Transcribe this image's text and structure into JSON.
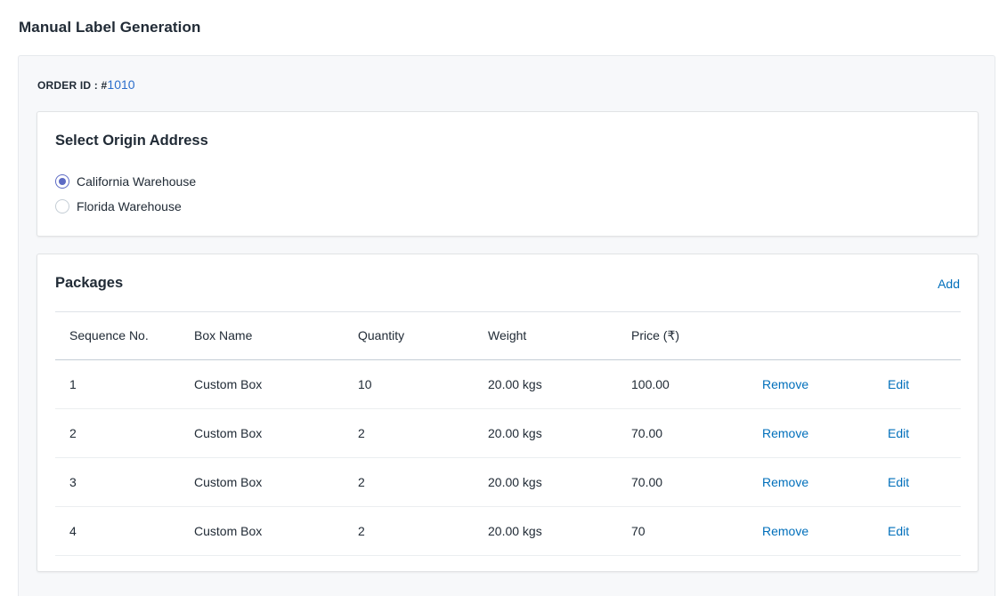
{
  "page": {
    "title": "Manual Label Generation"
  },
  "order": {
    "label": "ORDER ID : #",
    "value": "1010"
  },
  "origin": {
    "title": "Select Origin Address",
    "options": [
      {
        "label": "California Warehouse",
        "checked": true
      },
      {
        "label": "Florida Warehouse",
        "checked": false
      }
    ]
  },
  "packages": {
    "title": "Packages",
    "add_label": "Add",
    "columns": [
      "Sequence No.",
      "Box Name",
      "Quantity",
      "Weight",
      "Price (₹)"
    ],
    "rows": [
      {
        "seq": "1",
        "box": "Custom Box",
        "qty": "10",
        "weight": "20.00 kgs",
        "price": "100.00",
        "remove": "Remove",
        "edit": "Edit"
      },
      {
        "seq": "2",
        "box": "Custom Box",
        "qty": "2",
        "weight": "20.00 kgs",
        "price": "70.00",
        "remove": "Remove",
        "edit": "Edit"
      },
      {
        "seq": "3",
        "box": "Custom Box",
        "qty": "2",
        "weight": "20.00 kgs",
        "price": "70.00",
        "remove": "Remove",
        "edit": "Edit"
      },
      {
        "seq": "4",
        "box": "Custom Box",
        "qty": "2",
        "weight": "20.00 kgs",
        "price": "70",
        "remove": "Remove",
        "edit": "Edit"
      }
    ]
  },
  "colors": {
    "accent_radio": "#5c6ac4",
    "link": "#006fbb",
    "panel_bg": "#f7f8fa"
  }
}
